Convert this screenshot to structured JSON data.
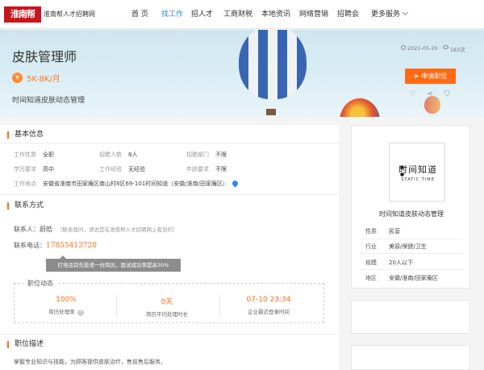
{
  "header": {
    "logo_text": "淮南帮",
    "site_name": "淮南帮人才招聘网",
    "nav": [
      "首 页",
      "找工作",
      "招人才",
      "工商财税",
      "本地资讯",
      "网络营销",
      "招聘会",
      "更多服务"
    ],
    "active_index": 1,
    "active_color": "#2c8ce6"
  },
  "job": {
    "title": "皮肤管理师",
    "salary": "5K-8K/月",
    "salary_icon": "yen-icon",
    "company": "时间知道皮肤动态管理",
    "date": "2021-05-20",
    "views": "183次",
    "apply_label": "申请职位",
    "accent_color": "#ff6a13"
  },
  "basic": {
    "title": "基本信息",
    "rows": [
      [
        [
          "工作性质",
          "全职"
        ],
        [
          "招聘人数",
          "8人"
        ],
        [
          "招聘部门",
          "不限"
        ]
      ],
      [
        [
          "学历要求",
          "高中"
        ],
        [
          "工作经验",
          "无经验"
        ],
        [
          "年龄要求",
          "不限"
        ]
      ]
    ],
    "address_label": "工作地点",
    "address": "安徽省淮南市田家庵区南山村8区69-101时间知道（安徽/淮南/田家庵区）"
  },
  "contact": {
    "title": "联系方式",
    "person_label": "联系人：",
    "person": "蔚皓",
    "note": "（联系我时，请说是在淮南帮人才招聘网上看到的）",
    "phone_label": "联系电话：",
    "phone": "17855413720",
    "tip": "打电话前先投递一份简历，面试成功率提高30%"
  },
  "dynamics": {
    "title": "职位动态",
    "items": [
      {
        "value": "100%",
        "label": "简历处理率"
      },
      {
        "value": "0天",
        "label": "简历平均处理时长"
      },
      {
        "value": "07-10 23:34",
        "label": "企业最近登录时间"
      }
    ]
  },
  "description": {
    "title": "职位描述",
    "text": "掌握专业知识与技能，为顾客提供皮肤治疗，售前售后服务。"
  },
  "company_card": {
    "logo_cn": "时间知道",
    "logo_en": "STATIC TIME",
    "name": "时间知道皮肤动态管理",
    "rows": [
      {
        "k": "性质",
        "v": "民营"
      },
      {
        "k": "行业",
        "v": "美容/保健/卫生"
      },
      {
        "k": "规模",
        "v": "20人以下"
      },
      {
        "k": "地区",
        "v": "安徽/淮南/田家庵区"
      }
    ]
  }
}
